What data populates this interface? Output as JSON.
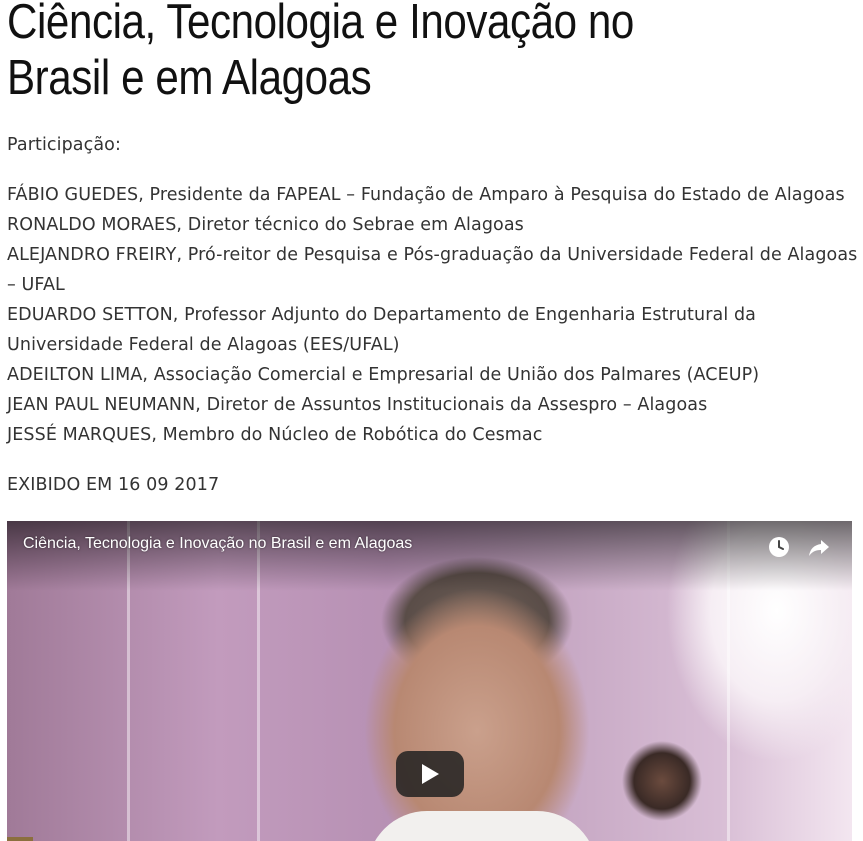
{
  "title": "Ciência, Tecnologia e Inovação no Brasil e em Alagoas",
  "participation_label": "Participação:",
  "participants": [
    "FÁBIO GUEDES, Presidente da FAPEAL – Fundação de Amparo à Pesquisa do Estado de Alagoas",
    "RONALDO MORAES, Diretor técnico do Sebrae em Alagoas",
    "ALEJANDRO FREIRY, Pró-reitor de Pesquisa e Pós-graduação da Universidade Federal de Alagoas – UFAL",
    "EDUARDO SETTON, Professor Adjunto do Departamento de Engenharia Estrutural da Universidade Federal de Alagoas (EES/UFAL)",
    "ADEILTON LIMA, Associação Comercial e Empresarial de União dos Palmares (ACEUP)",
    "JEAN PAUL NEUMANN, Diretor de Assuntos Institucionais da Assespro – Alagoas",
    "JESSÉ MARQUES, Membro do Núcleo de Robótica do Cesmac"
  ],
  "aired": "EXIBIDO EM 16 09 2017",
  "video": {
    "title": "Ciência, Tecnologia e Inovação no Brasil e em Alagoas",
    "icons": [
      "watch-later-icon",
      "share-icon",
      "play-icon"
    ]
  }
}
